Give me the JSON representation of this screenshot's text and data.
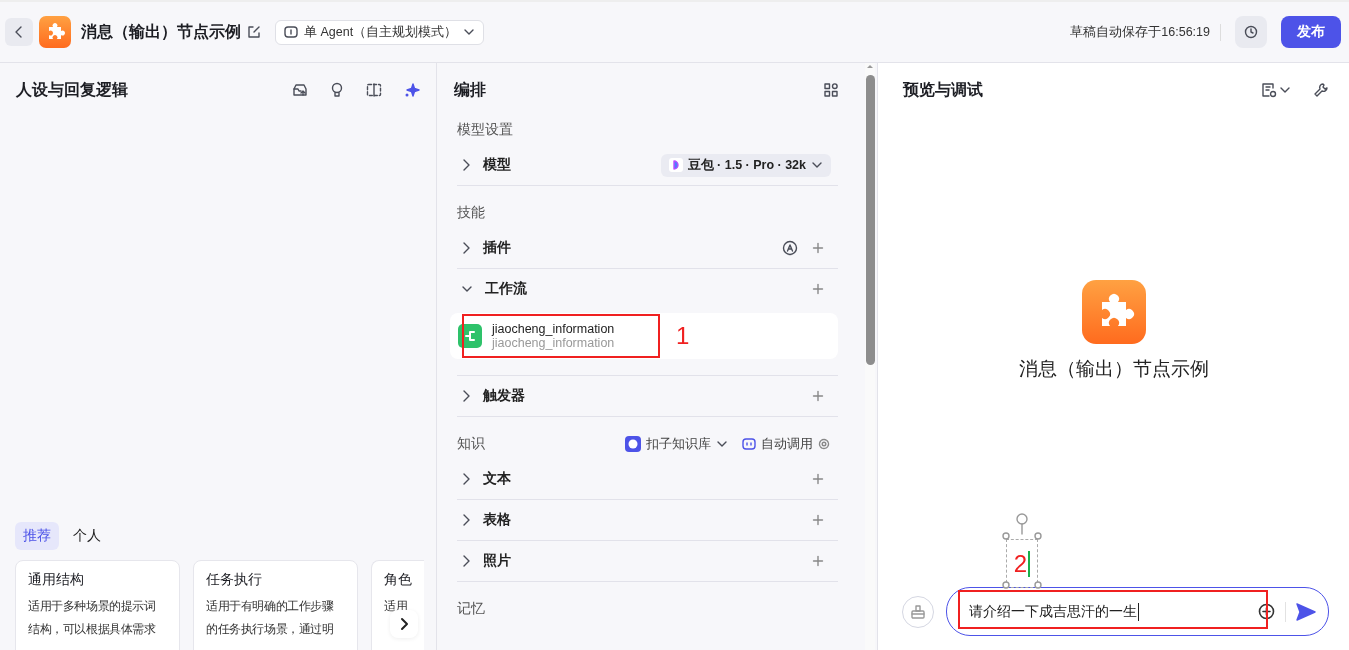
{
  "header": {
    "title": "消息（输出）节点示例",
    "mode": "单 Agent（自主规划模式）",
    "autosave": "草稿自动保存于16:56:19",
    "publish": "发布"
  },
  "prompt_panel": {
    "title": "人设与回复逻辑",
    "tabs": [
      {
        "label": "推荐",
        "selected": true
      },
      {
        "label": "个人",
        "selected": false
      }
    ],
    "cards": [
      {
        "title": "通用结构",
        "description": "适用于多种场景的提示词结构，可以根据具体需求"
      },
      {
        "title": "任务执行",
        "description": "适用于有明确的工作步骤的任务执行场景，通过明"
      },
      {
        "title": "角色",
        "description": "适用"
      }
    ]
  },
  "arrange_panel": {
    "title": "编排",
    "sections": [
      {
        "heading": "模型设置",
        "rows": [
          {
            "label": "模型",
            "kind": "model",
            "expanded": false,
            "value": "豆包 · 1.5 · Pro · 32k"
          }
        ]
      },
      {
        "heading": "技能",
        "rows": [
          {
            "label": "插件",
            "kind": "plugin",
            "expanded": false
          },
          {
            "label": "工作流",
            "kind": "add",
            "expanded": true,
            "items": [
              {
                "name": "jiaocheng_information",
                "subtitle": "jiaocheng_information"
              }
            ]
          },
          {
            "label": "触发器",
            "kind": "add",
            "expanded": false
          }
        ]
      },
      {
        "heading": "知识",
        "source": "扣子知识库",
        "mode": "自动调用",
        "rows": [
          {
            "label": "文本",
            "kind": "add",
            "expanded": false
          },
          {
            "label": "表格",
            "kind": "add",
            "expanded": false
          },
          {
            "label": "照片",
            "kind": "add",
            "expanded": false
          }
        ]
      },
      {
        "heading": "记忆"
      }
    ]
  },
  "preview_panel": {
    "title": "预览与调试",
    "bot_name": "消息（输出）节点示例",
    "input": {
      "value": "请介绍一下成吉思汗的一生"
    }
  },
  "annotations": [
    {
      "label": "1"
    },
    {
      "label": "2"
    }
  ]
}
